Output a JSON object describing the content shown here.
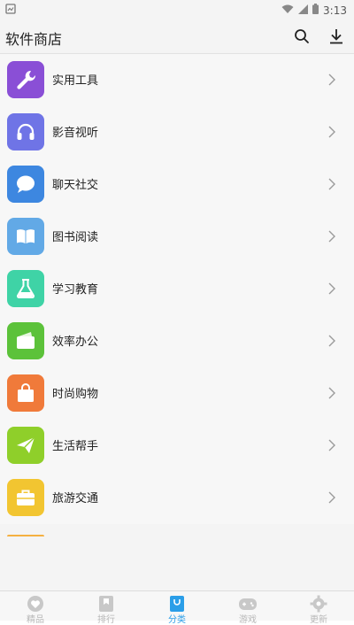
{
  "status_bar": {
    "time": "3:13"
  },
  "header": {
    "title": "软件商店"
  },
  "categories": [
    {
      "label": "实用工具",
      "icon": "wrench-icon",
      "color": "#8a4fd6"
    },
    {
      "label": "影音视听",
      "icon": "headphones-icon",
      "color": "#6f74e6"
    },
    {
      "label": "聊天社交",
      "icon": "chat-bubble-icon",
      "color": "#3d87e0"
    },
    {
      "label": "图书阅读",
      "icon": "book-icon",
      "color": "#62a9e6"
    },
    {
      "label": "学习教育",
      "icon": "flask-icon",
      "color": "#3fd3a6"
    },
    {
      "label": "效率办公",
      "icon": "wallet-icon",
      "color": "#5cc23a"
    },
    {
      "label": "时尚购物",
      "icon": "shopping-bag-icon",
      "color": "#f07a3a"
    },
    {
      "label": "生活帮手",
      "icon": "paper-plane-icon",
      "color": "#8fcf2a"
    },
    {
      "label": "旅游交通",
      "icon": "suitcase-icon",
      "color": "#f2c531"
    }
  ],
  "bottom_nav": [
    {
      "label": "精品",
      "icon": "heart-icon",
      "active": false
    },
    {
      "label": "排行",
      "icon": "bookmark-icon",
      "active": false
    },
    {
      "label": "分类",
      "icon": "bag-icon",
      "active": true
    },
    {
      "label": "游戏",
      "icon": "gamepad-icon",
      "active": false
    },
    {
      "label": "更新",
      "icon": "gear-icon",
      "active": false
    }
  ],
  "colors": {
    "accent": "#2b9ee8",
    "inactive": "#b8b8b8"
  }
}
